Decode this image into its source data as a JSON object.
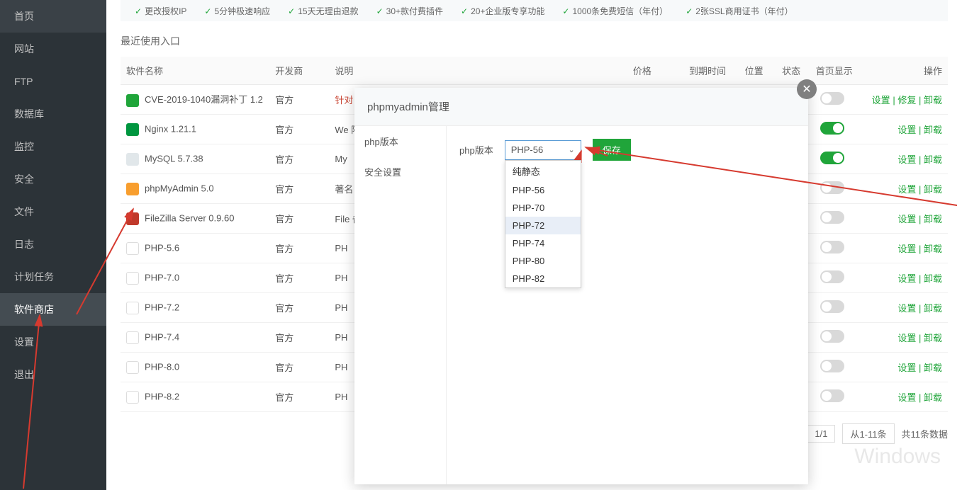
{
  "sidebar": {
    "items": [
      {
        "label": "首页"
      },
      {
        "label": "网站"
      },
      {
        "label": "FTP"
      },
      {
        "label": "数据库"
      },
      {
        "label": "监控"
      },
      {
        "label": "安全"
      },
      {
        "label": "文件"
      },
      {
        "label": "日志"
      },
      {
        "label": "计划任务"
      },
      {
        "label": "软件商店",
        "active": true
      },
      {
        "label": "设置"
      },
      {
        "label": "退出"
      }
    ]
  },
  "banner": {
    "items": [
      "更改授权IP",
      "5分钟极速响应",
      "15天无理由退款",
      "30+款付费插件",
      "20+企业版专享功能",
      "1000条免费短信（年付）",
      "2张SSL商用证书（年付）"
    ]
  },
  "section_title": "最近使用入口",
  "table": {
    "headers": {
      "name": "软件名称",
      "dev": "开发商",
      "desc": "说明",
      "price": "价格",
      "expire": "到期时间",
      "pos": "位置",
      "status": "状态",
      "home": "首页显示",
      "action": "操作"
    },
    "rows": [
      {
        "icon": "waf",
        "name": "CVE-2019-1040漏洞补丁 1.2",
        "dev": "官方",
        "desc": "针对",
        "desc_red": true,
        "toggle": "off",
        "actions": [
          "设置",
          "修复",
          "卸载"
        ]
      },
      {
        "icon": "nginx",
        "name": "Nginx 1.21.1",
        "dev": "官方",
        "desc": "We\n降低",
        "toggle": "on",
        "actions": [
          "设置",
          "卸载"
        ]
      },
      {
        "icon": "mysql",
        "name": "MySQL 5.7.38",
        "dev": "官方",
        "desc": "My",
        "toggle": "on",
        "actions": [
          "设置",
          "卸载"
        ]
      },
      {
        "icon": "pma",
        "name": "phpMyAdmin 5.0",
        "dev": "官方",
        "desc": "著名",
        "toggle": "off",
        "actions": [
          "设置",
          "卸载"
        ]
      },
      {
        "icon": "fz",
        "name": "FileZilla Server 0.9.60",
        "dev": "官方",
        "desc": "File\n备份",
        "toggle": "off",
        "actions": [
          "设置",
          "卸载"
        ]
      },
      {
        "icon": "php",
        "name": "PHP-5.6",
        "dev": "官方",
        "desc": "PH",
        "toggle": "off",
        "actions": [
          "设置",
          "卸载"
        ]
      },
      {
        "icon": "php",
        "name": "PHP-7.0",
        "dev": "官方",
        "desc": "PH",
        "toggle": "off",
        "actions": [
          "设置",
          "卸载"
        ]
      },
      {
        "icon": "php",
        "name": "PHP-7.2",
        "dev": "官方",
        "desc": "PH",
        "toggle": "off",
        "actions": [
          "设置",
          "卸载"
        ]
      },
      {
        "icon": "php",
        "name": "PHP-7.4",
        "dev": "官方",
        "desc": "PH",
        "toggle": "off",
        "actions": [
          "设置",
          "卸载"
        ]
      },
      {
        "icon": "php",
        "name": "PHP-8.0",
        "dev": "官方",
        "desc": "PH",
        "toggle": "off",
        "actions": [
          "设置",
          "卸载"
        ]
      },
      {
        "icon": "php",
        "name": "PHP-8.2",
        "dev": "官方",
        "desc": "PH",
        "toggle": "off",
        "actions": [
          "设置",
          "卸载"
        ]
      }
    ]
  },
  "pagination": {
    "current": "1",
    "pages": "1/1",
    "range": "从1-11条",
    "total": "共11条数据"
  },
  "modal": {
    "title": "phpmyadmin管理",
    "side": [
      {
        "label": "php版本",
        "active": true
      },
      {
        "label": "安全设置"
      }
    ],
    "form_label": "php版本",
    "select_value": "PHP-56",
    "save": "保存",
    "options": [
      {
        "label": "纯静态"
      },
      {
        "label": "PHP-56"
      },
      {
        "label": "PHP-70"
      },
      {
        "label": "PHP-72",
        "hover": true
      },
      {
        "label": "PHP-74"
      },
      {
        "label": "PHP-80"
      },
      {
        "label": "PHP-82"
      }
    ]
  },
  "watermark": "Windows"
}
